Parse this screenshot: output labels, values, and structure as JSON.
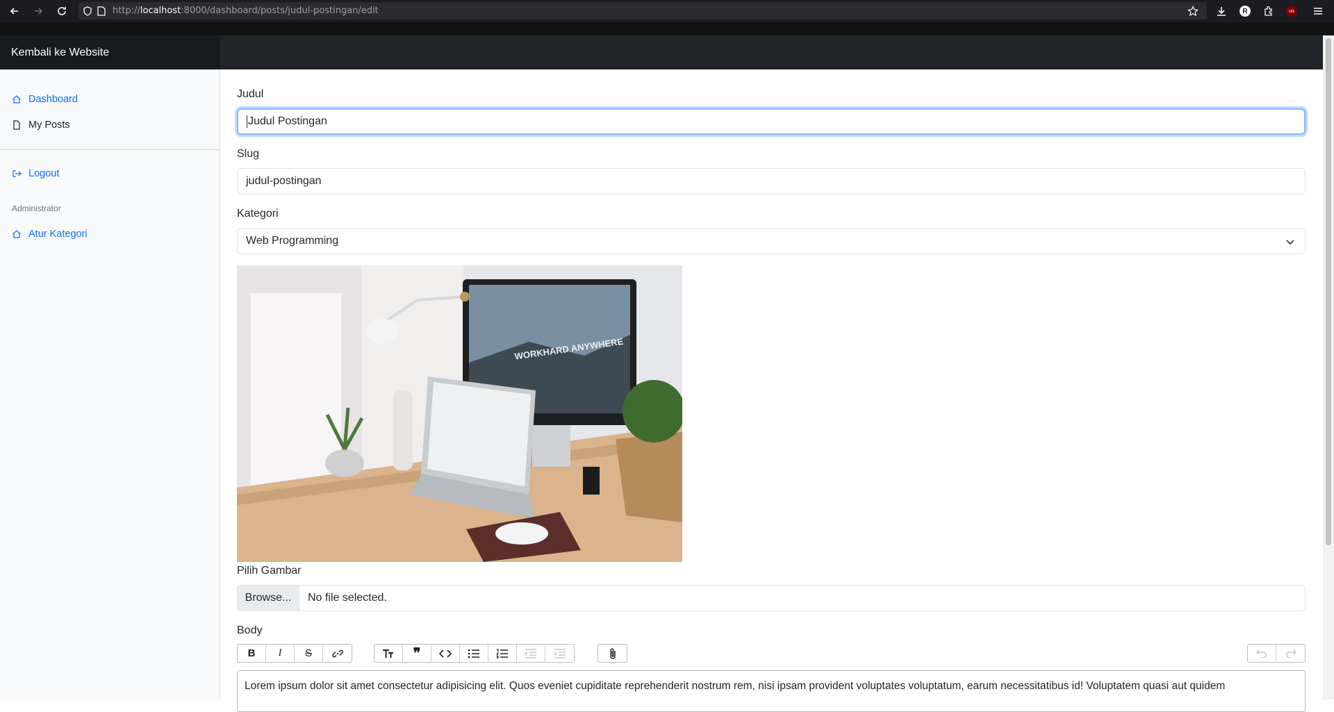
{
  "browser": {
    "url_scheme": "http://",
    "url_host": "localhost",
    "url_rest": ":8000/dashboard/posts/judul-postingan/edit"
  },
  "navbar": {
    "brand": "Kembali ke Website"
  },
  "sidebar": {
    "items": [
      {
        "label": "Dashboard",
        "icon": "home-icon"
      },
      {
        "label": "My Posts",
        "icon": "file-icon"
      },
      {
        "label": "Logout",
        "icon": "logout-icon"
      }
    ],
    "admin_heading": "Administrator",
    "admin_items": [
      {
        "label": "Atur Kategori",
        "icon": "home-icon"
      }
    ]
  },
  "form": {
    "title_label": "Judul",
    "title_value": "Judul Postingan",
    "slug_label": "Slug",
    "slug_value": "judul-postingan",
    "category_label": "Kategori",
    "category_value": "Web Programming",
    "image_label": "Pilih Gambar",
    "browse_label": "Browse...",
    "no_file_text": "No file selected.",
    "body_label": "Body",
    "body_text": "Lorem ipsum dolor sit amet consectetur adipisicing elit. Quos eveniet cupiditate reprehenderit nostrum rem, nisi ipsam provident voluptates voluptatum, earum necessitatibus id! Voluptatem quasi aut quidem"
  },
  "preview_image": {
    "caption": "WORKHARD ANYWHERE"
  },
  "colors": {
    "accent": "#0d6efd",
    "navbar": "#212529",
    "sidebar": "#f8f9fa"
  }
}
